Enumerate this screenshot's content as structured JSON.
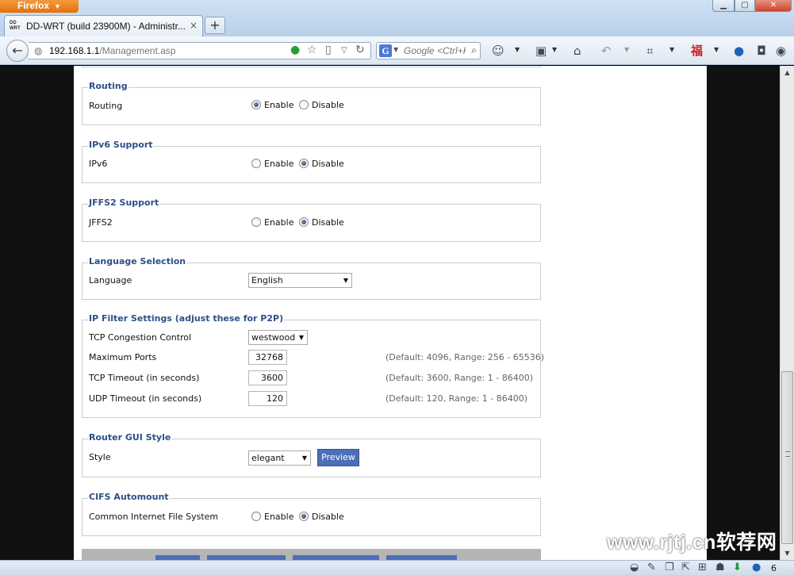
{
  "browser": {
    "app_button": "Firefox",
    "tab_title": "DD-WRT (build 23900M) - Administr...",
    "favicon_text": "DD-WRT",
    "new_tab": "+",
    "tab_close": "×",
    "url_host": "192.168.1.1",
    "url_path": "/Management.asp",
    "search_placeholder": "Google <Ctrl+K>",
    "search_engine": "G"
  },
  "sections": {
    "routing": {
      "legend": "Routing",
      "label": "Routing",
      "selected": "Enable"
    },
    "ipv6": {
      "legend": "IPv6 Support",
      "label": "IPv6",
      "selected": "Disable"
    },
    "jffs2": {
      "legend": "JFFS2 Support",
      "label": "JFFS2",
      "selected": "Disable"
    },
    "language": {
      "legend": "Language Selection",
      "label": "Language",
      "value": "English"
    },
    "ipfilter": {
      "legend": "IP Filter Settings (adjust these for P2P)",
      "tcp_congestion_label": "TCP Congestion Control",
      "tcp_congestion_value": "westwood",
      "max_ports_label": "Maximum Ports",
      "max_ports_value": "32768",
      "max_ports_hint": "(Default: 4096, Range: 256 - 65536)",
      "tcp_timeout_label": "TCP Timeout (in seconds)",
      "tcp_timeout_value": "3600",
      "tcp_timeout_hint": "(Default: 3600, Range: 1 - 86400)",
      "udp_timeout_label": "UDP Timeout (in seconds)",
      "udp_timeout_value": "120",
      "udp_timeout_hint": "(Default: 120, Range: 1 - 86400)"
    },
    "gui_style": {
      "legend": "Router GUI Style",
      "label": "Style",
      "value": "elegant",
      "preview_button": "Preview"
    },
    "cifs": {
      "legend": "CIFS Automount",
      "label": "Common Internet File System",
      "selected": "Disable"
    }
  },
  "radio_labels": {
    "enable": "Enable",
    "disable": "Disable"
  },
  "watermark": "www.rjtj.cn软荐网",
  "status": {
    "download_count": "6"
  }
}
